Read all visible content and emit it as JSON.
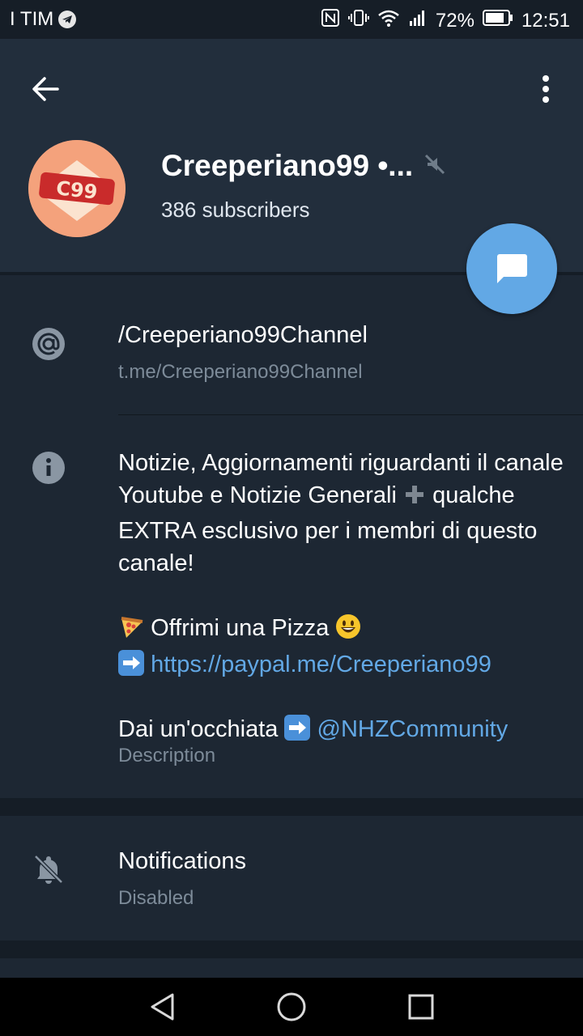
{
  "status_bar": {
    "carrier": "I TIM",
    "battery": "72%",
    "time": "12:51"
  },
  "header": {
    "channel_name": "Creeperiano99 •...",
    "subscribers": "386 subscribers",
    "avatar_text": "C99"
  },
  "username_row": {
    "title": "/Creeperiano99Channel",
    "subtitle": "t.me/Creeperiano99Channel"
  },
  "description_row": {
    "line1": "Notizie, Aggiornamenti riguardanti il canale Youtube e Notizie Generali",
    "line1_tail": "qualche EXTRA esclusivo per i membri di questo canale!",
    "pizza_text": "Offrimi una Pizza",
    "paypal_link": "https://paypal.me/Creeperiano99",
    "look_text": "Dai un'occhiata",
    "community_link": "@NHZCommunity",
    "label": "Description"
  },
  "notifications_row": {
    "title": "Notifications",
    "subtitle": "Disabled"
  },
  "colors": {
    "accent": "#62a8e5",
    "header_bg": "#222e3c",
    "body_bg": "#1d2733"
  }
}
